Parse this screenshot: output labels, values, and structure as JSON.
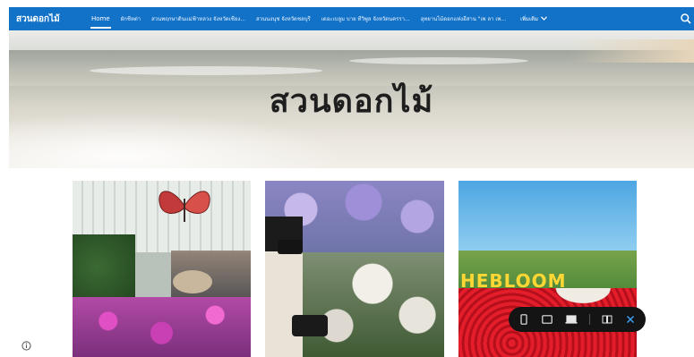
{
  "navbar": {
    "brand": "สวนดอกไม้",
    "items": [
      "Home",
      "ผักชีหต่า",
      "สวนพฤกษาดินแม่ฟ้าหลวง จังหวัดเชียง...",
      "สวนนงนุช จังหวัดชลบุรี",
      "เดอะเบลูม บาย ทีวิพูล จังหวัดนครรา...",
      "อุทยานไม้ดอกแห่งอีสาน \"เพ ลา เพ...",
      "เพิ่มเติม"
    ],
    "icons": {
      "more": "chevron-down-icon",
      "search": "search-icon"
    }
  },
  "hero": {
    "title": "สวนดอกไม้"
  },
  "gallery": {
    "photo3_sign": "HEBLOOM"
  },
  "device_bar": {
    "icons": [
      "phone-icon",
      "tablet-icon",
      "laptop-icon",
      "book-icon",
      "close-icon"
    ]
  },
  "colors": {
    "nav_bg": "#1272c8",
    "device_bar_bg": "#141414",
    "close_accent": "#3aa0ff"
  }
}
